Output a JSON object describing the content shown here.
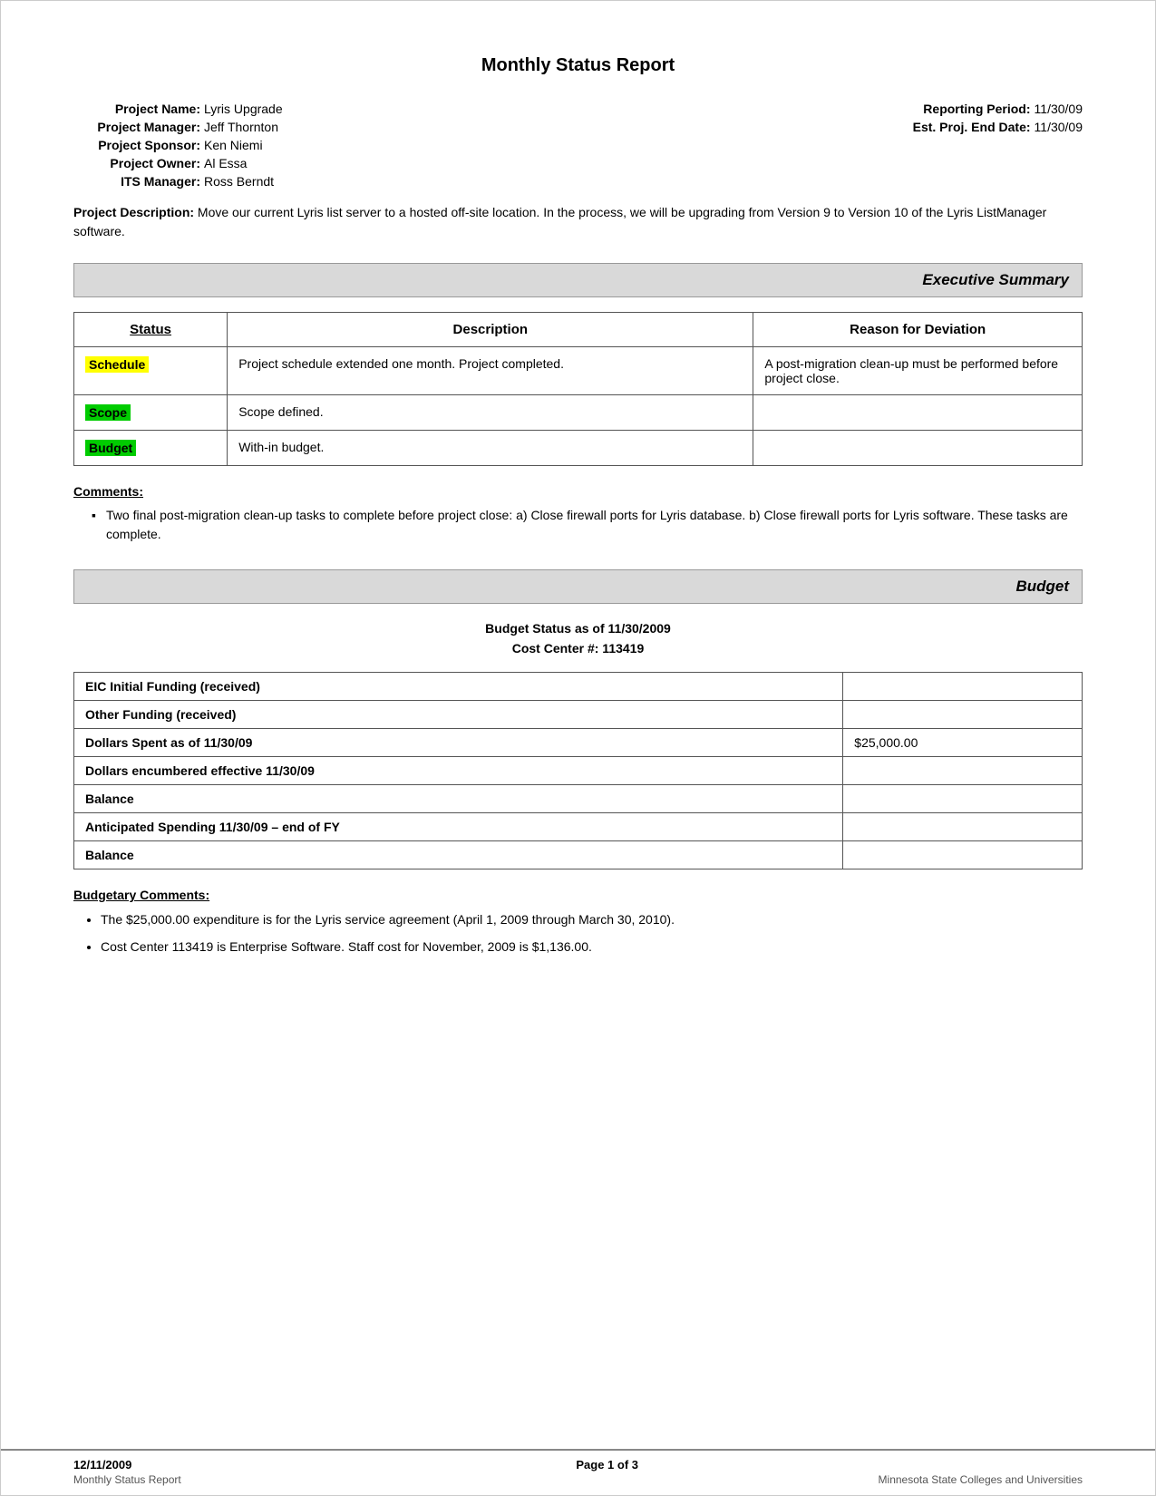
{
  "page": {
    "title": "Monthly Status Report",
    "meta": {
      "left": [
        {
          "label": "Project Name:",
          "value": "Lyris Upgrade"
        },
        {
          "label": "Project Manager:",
          "value": "Jeff Thornton"
        },
        {
          "label": "Project Sponsor:",
          "value": "Ken Niemi"
        },
        {
          "label": "Project Owner:",
          "value": "Al Essa"
        },
        {
          "label": "ITS Manager:",
          "value": "Ross Berndt"
        }
      ],
      "right": [
        {
          "label": "Reporting Period:",
          "value": "11/30/09"
        },
        {
          "label": "Est. Proj. End Date:",
          "value": "11/30/09"
        }
      ]
    },
    "description_label": "Project Description:",
    "description_text": "Move our current Lyris list server to a hosted off-site location.  In the process, we will be upgrading from Version 9 to Version 10 of the Lyris ListManager software.",
    "exec_summary": {
      "section_title": "Executive Summary",
      "table": {
        "headers": [
          "Status",
          "Description",
          "Reason for Deviation"
        ],
        "rows": [
          {
            "status": "Schedule",
            "status_color": "yellow",
            "description": "Project schedule extended one month.  Project completed.",
            "reason": "A post-migration clean-up must be performed before project close."
          },
          {
            "status": "Scope",
            "status_color": "green",
            "description": "Scope defined.",
            "reason": ""
          },
          {
            "status": "Budget",
            "status_color": "green",
            "description": "With-in budget.",
            "reason": ""
          }
        ]
      }
    },
    "comments": {
      "label": "Comments:",
      "items": [
        "Two final post-migration clean-up tasks to complete before project close:  a) Close firewall ports for Lyris database.  b) Close firewall ports for Lyris software.  These tasks are complete."
      ]
    },
    "budget": {
      "section_title": "Budget",
      "status_line1": "Budget Status as of 11/30/2009",
      "status_line2": "Cost Center #: 113419",
      "table_rows": [
        {
          "label": "EIC Initial Funding (received)",
          "value": ""
        },
        {
          "label": "Other Funding (received)",
          "value": ""
        },
        {
          "label": "Dollars Spent as of 11/30/09",
          "value": "$25,000.00"
        },
        {
          "label": "Dollars encumbered effective 11/30/09",
          "value": ""
        },
        {
          "label": "Balance",
          "value": ""
        },
        {
          "label": "Anticipated Spending 11/30/09 – end of FY",
          "value": ""
        },
        {
          "label": "Balance",
          "value": ""
        }
      ]
    },
    "budgetary_comments": {
      "label": "Budgetary Comments:",
      "items": [
        "The $25,000.00 expenditure is for the Lyris service agreement (April 1, 2009 through March 30, 2010).",
        "Cost Center 113419 is Enterprise Software.  Staff cost for November, 2009 is $1,136.00."
      ]
    },
    "footer": {
      "date": "12/11/2009",
      "page": "Page 1 of 3",
      "report_name": "Monthly Status Report",
      "institution": "Minnesota State Colleges and Universities"
    }
  }
}
